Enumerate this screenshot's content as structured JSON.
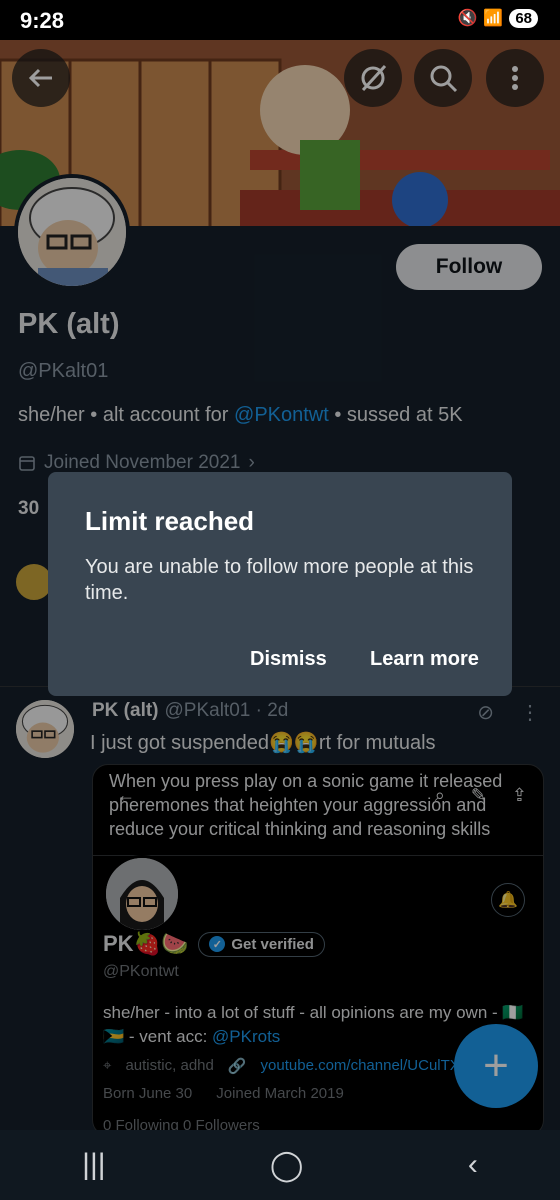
{
  "status": {
    "time": "9:28",
    "battery": "68"
  },
  "profile": {
    "follow_label": "Follow",
    "name": "PK (alt)",
    "handle": "@PKalt01",
    "bio_prefix": "she/her • alt account for ",
    "bio_link": "@PKontwt",
    "bio_suffix": " • sussed at 5K",
    "joined": "Joined November 2021",
    "counts_stub": "30"
  },
  "dialog": {
    "title": "Limit reached",
    "body": "You are unable to follow more people at this time.",
    "dismiss": "Dismiss",
    "learn_more": "Learn more"
  },
  "post": {
    "name": "PK (alt)",
    "meta": "@PKalt01 · 2d",
    "text": "I just got suspended😭😭rt for mutuals",
    "quote": {
      "text": "When you press play on a sonic game it released pheremones that heighten your aggression and reduce your critical thinking and reasoning skills",
      "name": "PK🍓🍉",
      "verify_label": "Get verified",
      "handle": "@PKontwt",
      "bio_prefix": "she/her - into a lot of stuff - all opinions are my own - 🇳🇬🇧🇸 - vent acc: ",
      "bio_link": "@PKrots",
      "location": "autistic, adhd",
      "website": "youtube.com/channel/UCulTX",
      "born": "Born June 30",
      "joined": "Joined March 2019",
      "counts": "0 Following   0 Followers"
    }
  },
  "fab": {
    "icon": "plus-icon"
  },
  "colors": {
    "accent": "#1d9bf0",
    "background": "#15202b",
    "dialog": "#394551"
  }
}
